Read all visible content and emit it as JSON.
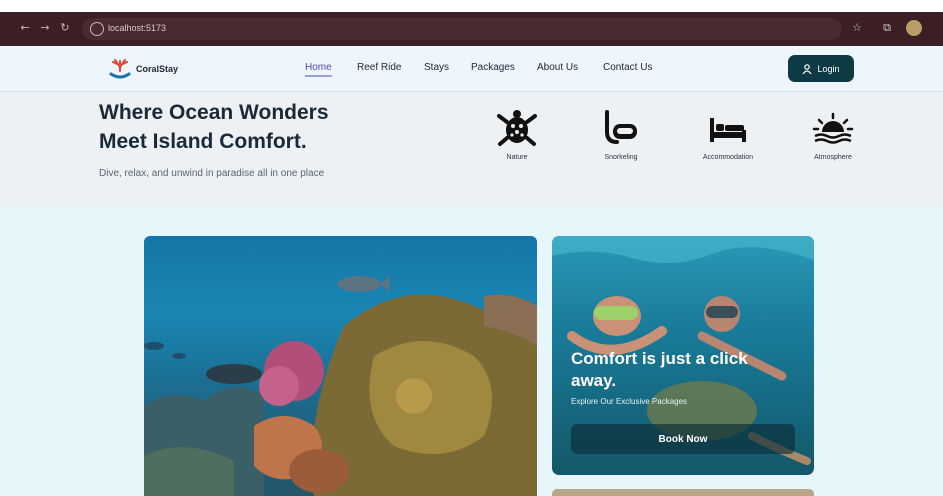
{
  "browser": {
    "url": "localhost:5173"
  },
  "nav": {
    "logo_text": "CoralStay",
    "links": [
      {
        "label": "Home",
        "active": true
      },
      {
        "label": "Reef Ride",
        "active": false
      },
      {
        "label": "Stays",
        "active": false
      },
      {
        "label": "Packages",
        "active": false
      },
      {
        "label": "About Us",
        "active": false
      },
      {
        "label": "Contact Us",
        "active": false
      }
    ],
    "login_label": "Login"
  },
  "hero": {
    "title_line1": "Where Ocean Wonders",
    "title_line2": "Meet Island Comfort.",
    "subtitle": "Dive, relax, and unwind in paradise all in one place",
    "features": [
      {
        "label": "Nature",
        "icon": "turtle-icon"
      },
      {
        "label": "Snorkeling",
        "icon": "snorkel-mask-icon"
      },
      {
        "label": "Accommodation",
        "icon": "bed-icon"
      },
      {
        "label": "Atmosphere",
        "icon": "sunset-icon"
      }
    ]
  },
  "promo": {
    "headline": "Comfort is just a click away.",
    "subtext": "Explore Our Exclusive Packages",
    "button_label": "Book Now"
  },
  "colors": {
    "chrome": "#3b1f25",
    "login_button": "#0d3a45",
    "page_background": "#e6f6fb"
  }
}
